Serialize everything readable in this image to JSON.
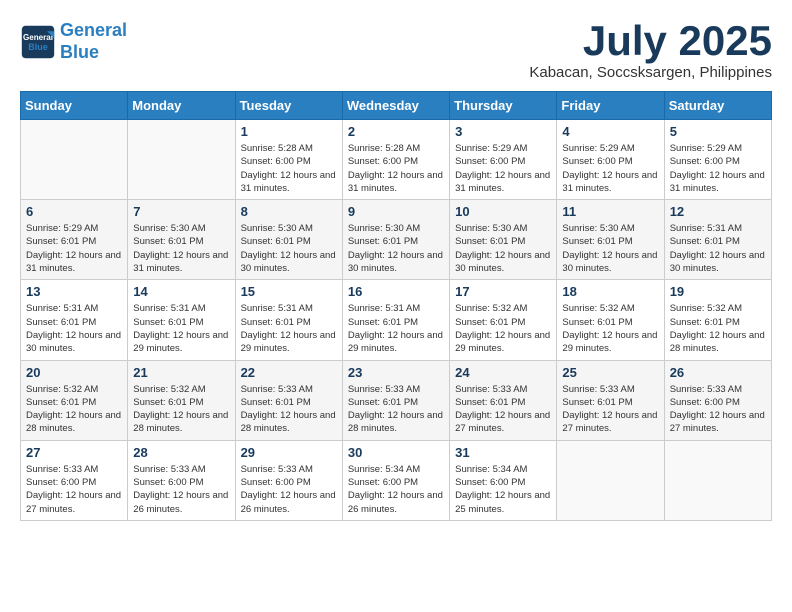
{
  "header": {
    "logo_line1": "General",
    "logo_line2": "Blue",
    "month_year": "July 2025",
    "location": "Kabacan, Soccsksargen, Philippines"
  },
  "weekdays": [
    "Sunday",
    "Monday",
    "Tuesday",
    "Wednesday",
    "Thursday",
    "Friday",
    "Saturday"
  ],
  "weeks": [
    [
      {
        "day": "",
        "info": ""
      },
      {
        "day": "",
        "info": ""
      },
      {
        "day": "1",
        "info": "Sunrise: 5:28 AM\nSunset: 6:00 PM\nDaylight: 12 hours and 31 minutes."
      },
      {
        "day": "2",
        "info": "Sunrise: 5:28 AM\nSunset: 6:00 PM\nDaylight: 12 hours and 31 minutes."
      },
      {
        "day": "3",
        "info": "Sunrise: 5:29 AM\nSunset: 6:00 PM\nDaylight: 12 hours and 31 minutes."
      },
      {
        "day": "4",
        "info": "Sunrise: 5:29 AM\nSunset: 6:00 PM\nDaylight: 12 hours and 31 minutes."
      },
      {
        "day": "5",
        "info": "Sunrise: 5:29 AM\nSunset: 6:00 PM\nDaylight: 12 hours and 31 minutes."
      }
    ],
    [
      {
        "day": "6",
        "info": "Sunrise: 5:29 AM\nSunset: 6:01 PM\nDaylight: 12 hours and 31 minutes."
      },
      {
        "day": "7",
        "info": "Sunrise: 5:30 AM\nSunset: 6:01 PM\nDaylight: 12 hours and 31 minutes."
      },
      {
        "day": "8",
        "info": "Sunrise: 5:30 AM\nSunset: 6:01 PM\nDaylight: 12 hours and 30 minutes."
      },
      {
        "day": "9",
        "info": "Sunrise: 5:30 AM\nSunset: 6:01 PM\nDaylight: 12 hours and 30 minutes."
      },
      {
        "day": "10",
        "info": "Sunrise: 5:30 AM\nSunset: 6:01 PM\nDaylight: 12 hours and 30 minutes."
      },
      {
        "day": "11",
        "info": "Sunrise: 5:30 AM\nSunset: 6:01 PM\nDaylight: 12 hours and 30 minutes."
      },
      {
        "day": "12",
        "info": "Sunrise: 5:31 AM\nSunset: 6:01 PM\nDaylight: 12 hours and 30 minutes."
      }
    ],
    [
      {
        "day": "13",
        "info": "Sunrise: 5:31 AM\nSunset: 6:01 PM\nDaylight: 12 hours and 30 minutes."
      },
      {
        "day": "14",
        "info": "Sunrise: 5:31 AM\nSunset: 6:01 PM\nDaylight: 12 hours and 29 minutes."
      },
      {
        "day": "15",
        "info": "Sunrise: 5:31 AM\nSunset: 6:01 PM\nDaylight: 12 hours and 29 minutes."
      },
      {
        "day": "16",
        "info": "Sunrise: 5:31 AM\nSunset: 6:01 PM\nDaylight: 12 hours and 29 minutes."
      },
      {
        "day": "17",
        "info": "Sunrise: 5:32 AM\nSunset: 6:01 PM\nDaylight: 12 hours and 29 minutes."
      },
      {
        "day": "18",
        "info": "Sunrise: 5:32 AM\nSunset: 6:01 PM\nDaylight: 12 hours and 29 minutes."
      },
      {
        "day": "19",
        "info": "Sunrise: 5:32 AM\nSunset: 6:01 PM\nDaylight: 12 hours and 28 minutes."
      }
    ],
    [
      {
        "day": "20",
        "info": "Sunrise: 5:32 AM\nSunset: 6:01 PM\nDaylight: 12 hours and 28 minutes."
      },
      {
        "day": "21",
        "info": "Sunrise: 5:32 AM\nSunset: 6:01 PM\nDaylight: 12 hours and 28 minutes."
      },
      {
        "day": "22",
        "info": "Sunrise: 5:33 AM\nSunset: 6:01 PM\nDaylight: 12 hours and 28 minutes."
      },
      {
        "day": "23",
        "info": "Sunrise: 5:33 AM\nSunset: 6:01 PM\nDaylight: 12 hours and 28 minutes."
      },
      {
        "day": "24",
        "info": "Sunrise: 5:33 AM\nSunset: 6:01 PM\nDaylight: 12 hours and 27 minutes."
      },
      {
        "day": "25",
        "info": "Sunrise: 5:33 AM\nSunset: 6:01 PM\nDaylight: 12 hours and 27 minutes."
      },
      {
        "day": "26",
        "info": "Sunrise: 5:33 AM\nSunset: 6:00 PM\nDaylight: 12 hours and 27 minutes."
      }
    ],
    [
      {
        "day": "27",
        "info": "Sunrise: 5:33 AM\nSunset: 6:00 PM\nDaylight: 12 hours and 27 minutes."
      },
      {
        "day": "28",
        "info": "Sunrise: 5:33 AM\nSunset: 6:00 PM\nDaylight: 12 hours and 26 minutes."
      },
      {
        "day": "29",
        "info": "Sunrise: 5:33 AM\nSunset: 6:00 PM\nDaylight: 12 hours and 26 minutes."
      },
      {
        "day": "30",
        "info": "Sunrise: 5:34 AM\nSunset: 6:00 PM\nDaylight: 12 hours and 26 minutes."
      },
      {
        "day": "31",
        "info": "Sunrise: 5:34 AM\nSunset: 6:00 PM\nDaylight: 12 hours and 25 minutes."
      },
      {
        "day": "",
        "info": ""
      },
      {
        "day": "",
        "info": ""
      }
    ]
  ]
}
